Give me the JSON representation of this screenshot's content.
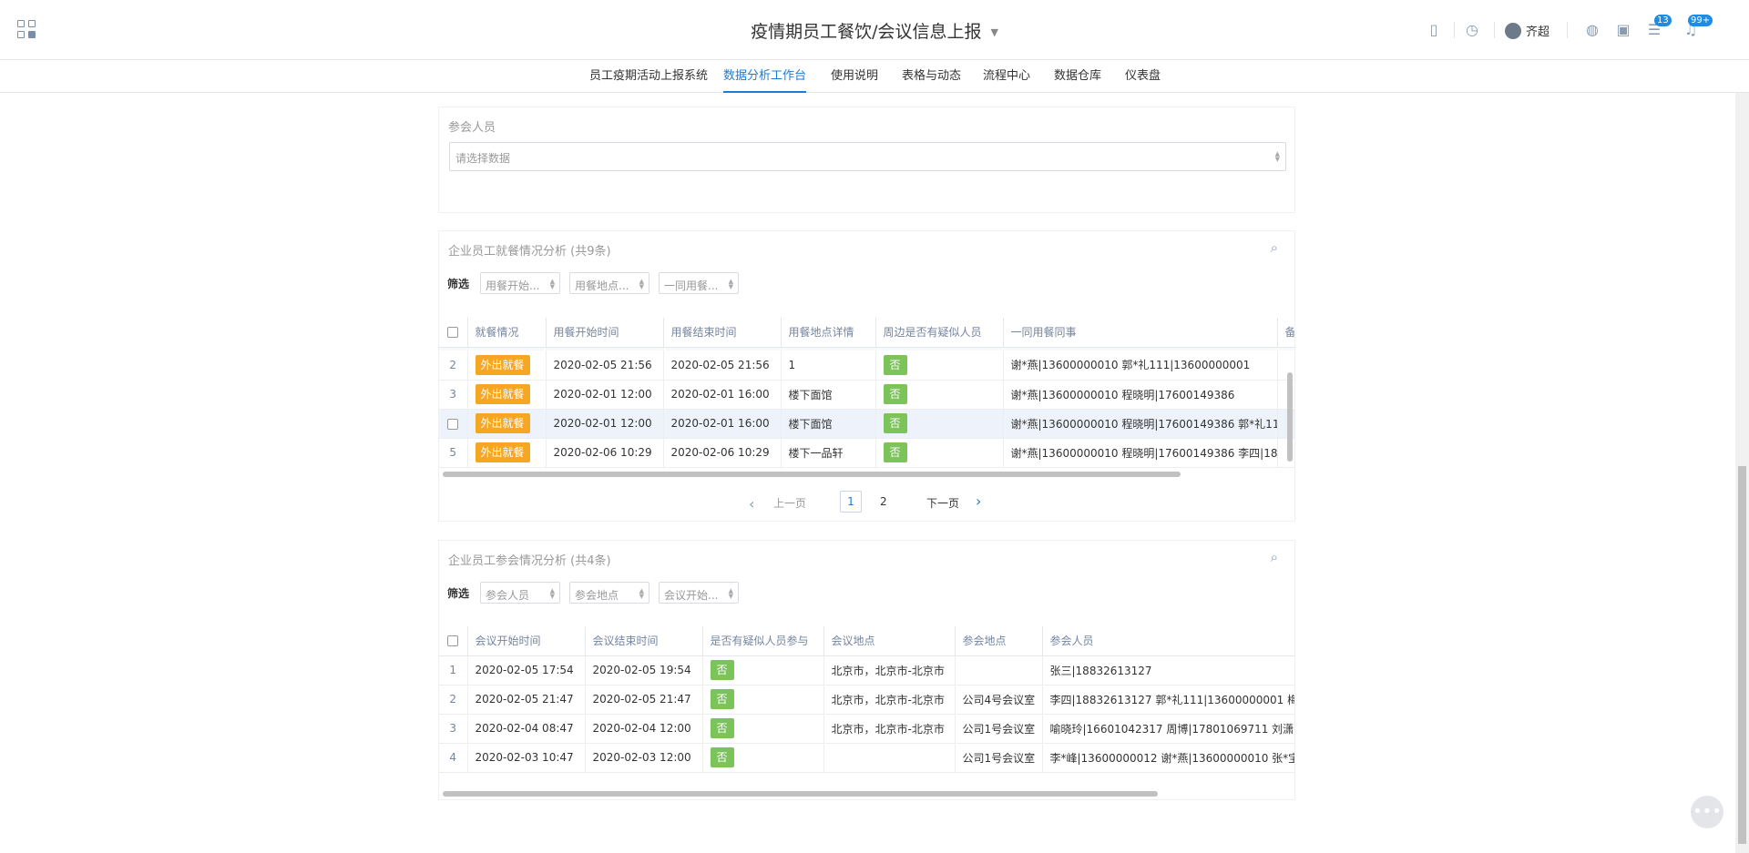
{
  "header": {
    "title": "疫情期员工餐饮/会议信息上报",
    "user_name": "齐超",
    "badge_tasks": "13",
    "badge_notifications": "99+"
  },
  "nav": {
    "items": [
      "员工疫期活动上报系统",
      "数据分析工作台",
      "使用说明",
      "表格与动态",
      "流程中心",
      "数据仓库",
      "仪表盘"
    ],
    "active_index": 1
  },
  "attendees_panel": {
    "label": "参会人员",
    "placeholder": "请选择数据"
  },
  "dining_panel": {
    "title": "企业员工就餐情况分析 (共9条)",
    "filter_label": "筛选",
    "filters": [
      "用餐开始...",
      "用餐地点...",
      "一同用餐..."
    ],
    "columns": [
      "就餐情况",
      "用餐开始时间",
      "用餐结束时间",
      "用餐地点详情",
      "周边是否有疑似人员",
      "一同用餐同事",
      "备注"
    ],
    "rows": [
      {
        "idx": "2",
        "status": "外出就餐",
        "start": "2020-02-05 21:56",
        "end": "2020-02-05 21:56",
        "place": "1",
        "suspect": "否",
        "colleagues": "谢*燕|13600000010 郭*礼111|13600000001"
      },
      {
        "idx": "3",
        "status": "外出就餐",
        "start": "2020-02-01 12:00",
        "end": "2020-02-01 16:00",
        "place": "楼下面馆",
        "suspect": "否",
        "colleagues": "谢*燕|13600000010 程晓明|17600149386"
      },
      {
        "idx": "",
        "status": "外出就餐",
        "start": "2020-02-01 12:00",
        "end": "2020-02-01 16:00",
        "place": "楼下面馆",
        "suspect": "否",
        "colleagues": "谢*燕|13600000010 程晓明|17600149386 郭*礼11"
      },
      {
        "idx": "5",
        "status": "外出就餐",
        "start": "2020-02-06 10:29",
        "end": "2020-02-06 10:29",
        "place": "楼下一品轩",
        "suspect": "否",
        "colleagues": "谢*燕|13600000010 程晓明|17600149386 李四|18"
      }
    ],
    "pager": {
      "prev": "上一页",
      "next": "下一页",
      "pages": [
        "1",
        "2"
      ],
      "current": "1"
    }
  },
  "meeting_panel": {
    "title": "企业员工参会情况分析 (共4条)",
    "filter_label": "筛选",
    "filters": [
      "参会人员",
      "参会地点",
      "会议开始..."
    ],
    "columns": [
      "会议开始时间",
      "会议结束时间",
      "是否有疑似人员参与",
      "会议地点",
      "参会地点",
      "参会人员"
    ],
    "rows": [
      {
        "idx": "1",
        "start": "2020-02-05 17:54",
        "end": "2020-02-05 19:54",
        "suspect": "否",
        "city": "北京市，北京市-北京市",
        "room": "",
        "people": "张三|18832613127"
      },
      {
        "idx": "2",
        "start": "2020-02-05 21:47",
        "end": "2020-02-05 21:47",
        "suspect": "否",
        "city": "北京市，北京市-北京市",
        "room": "公司4号会议室",
        "people": "李四|18832613127 郭*礼111|13600000001 梅"
      },
      {
        "idx": "3",
        "start": "2020-02-04 08:47",
        "end": "2020-02-04 12:00",
        "suspect": "否",
        "city": "北京市，北京市-北京市",
        "room": "公司1号会议室",
        "people": "喻晓玲|16601042317 周博|17801069711 刘潇"
      },
      {
        "idx": "4",
        "start": "2020-02-03 10:47",
        "end": "2020-02-03 12:00",
        "suspect": "否",
        "city": "",
        "room": "公司1号会议室",
        "people": "李*峰|13600000012 谢*燕|13600000010 张*宝"
      }
    ]
  },
  "icons": [
    "grid-icon",
    "phone-icon",
    "clock-icon",
    "globe-icon",
    "briefcase-icon",
    "tasks-icon",
    "bell-icon",
    "search-icon",
    "chevron-left-icon",
    "chevron-right-icon",
    "more-icon"
  ],
  "colors": {
    "accent": "#1e7bd3",
    "tag_orange": "#f5a623",
    "tag_green": "#7cc35a"
  }
}
